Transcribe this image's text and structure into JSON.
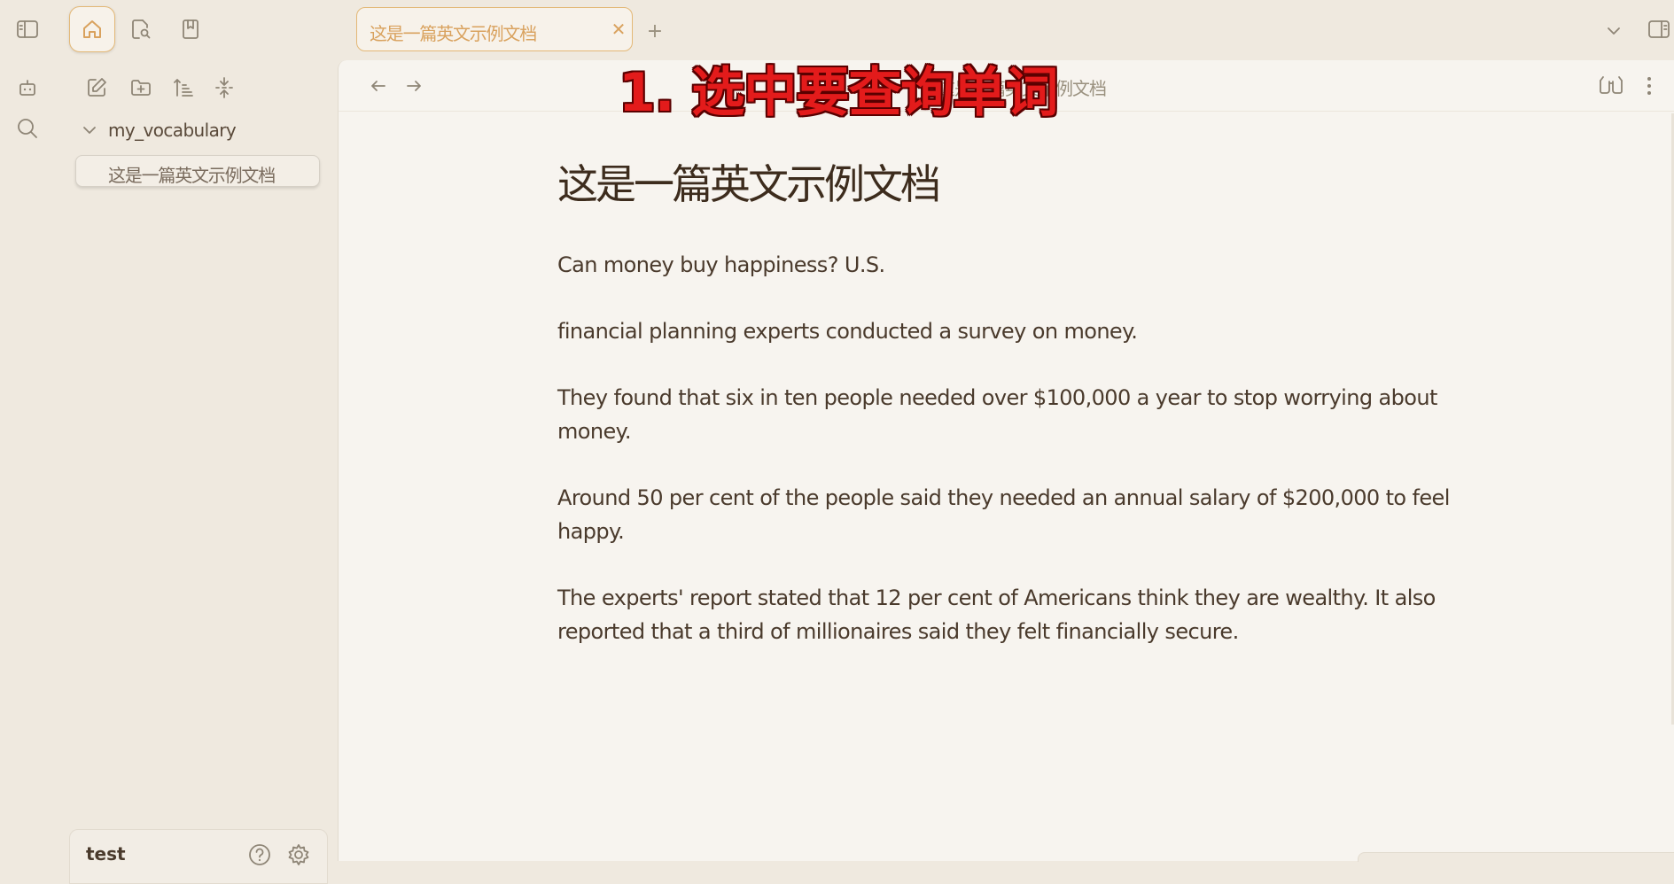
{
  "tabbar": {
    "active_tab_title": "这是一篇英文示例文档",
    "close_glyph": "✕",
    "new_tab_glyph": "+",
    "icons": [
      "sidebar-left-icon",
      "home-icon",
      "search-document-icon",
      "bookmark-icon",
      "chevron-down-icon",
      "sidebar-right-icon"
    ]
  },
  "ribbon": {
    "icons": [
      "bot-icon",
      "search-icon"
    ]
  },
  "file_panel": {
    "toolbar_icons": [
      "new-note-icon",
      "new-folder-icon",
      "sort-icon",
      "collapse-all-icon"
    ],
    "folder": "my_vocabulary",
    "files": [
      "这是一篇英文示例文档"
    ],
    "vault_name": "test",
    "footer_icons": [
      "help-icon",
      "settings-icon"
    ]
  },
  "editor": {
    "breadcrumb": "这是一篇英文示例文档",
    "title": "这是一篇英文示例文档",
    "paragraphs": [
      "Can money buy happiness? U.S.",
      "financial planning experts conducted a survey on money.",
      "They found that six in ten people needed over $100,000 a year to stop worrying about money.",
      "Around 50 per cent of the people said they needed an annual salary of $200,000 to feel happy.",
      "The experts' report stated that 12 per cent of Americans think they are wealthy. It also reported that a third of millionaires said they felt financially secure."
    ],
    "header_icons": [
      "arrow-left-icon",
      "arrow-right-icon",
      "reading-view-icon",
      "more-options-icon"
    ]
  },
  "annotation": {
    "text": "1. 选中要查询单词",
    "color": "#e31b1b"
  },
  "colors": {
    "accent": "#e3b877",
    "accent_text": "#d9a25e",
    "background": "#efe9df",
    "editor_background": "#f7f4ef",
    "text": "#4a3a2c"
  }
}
